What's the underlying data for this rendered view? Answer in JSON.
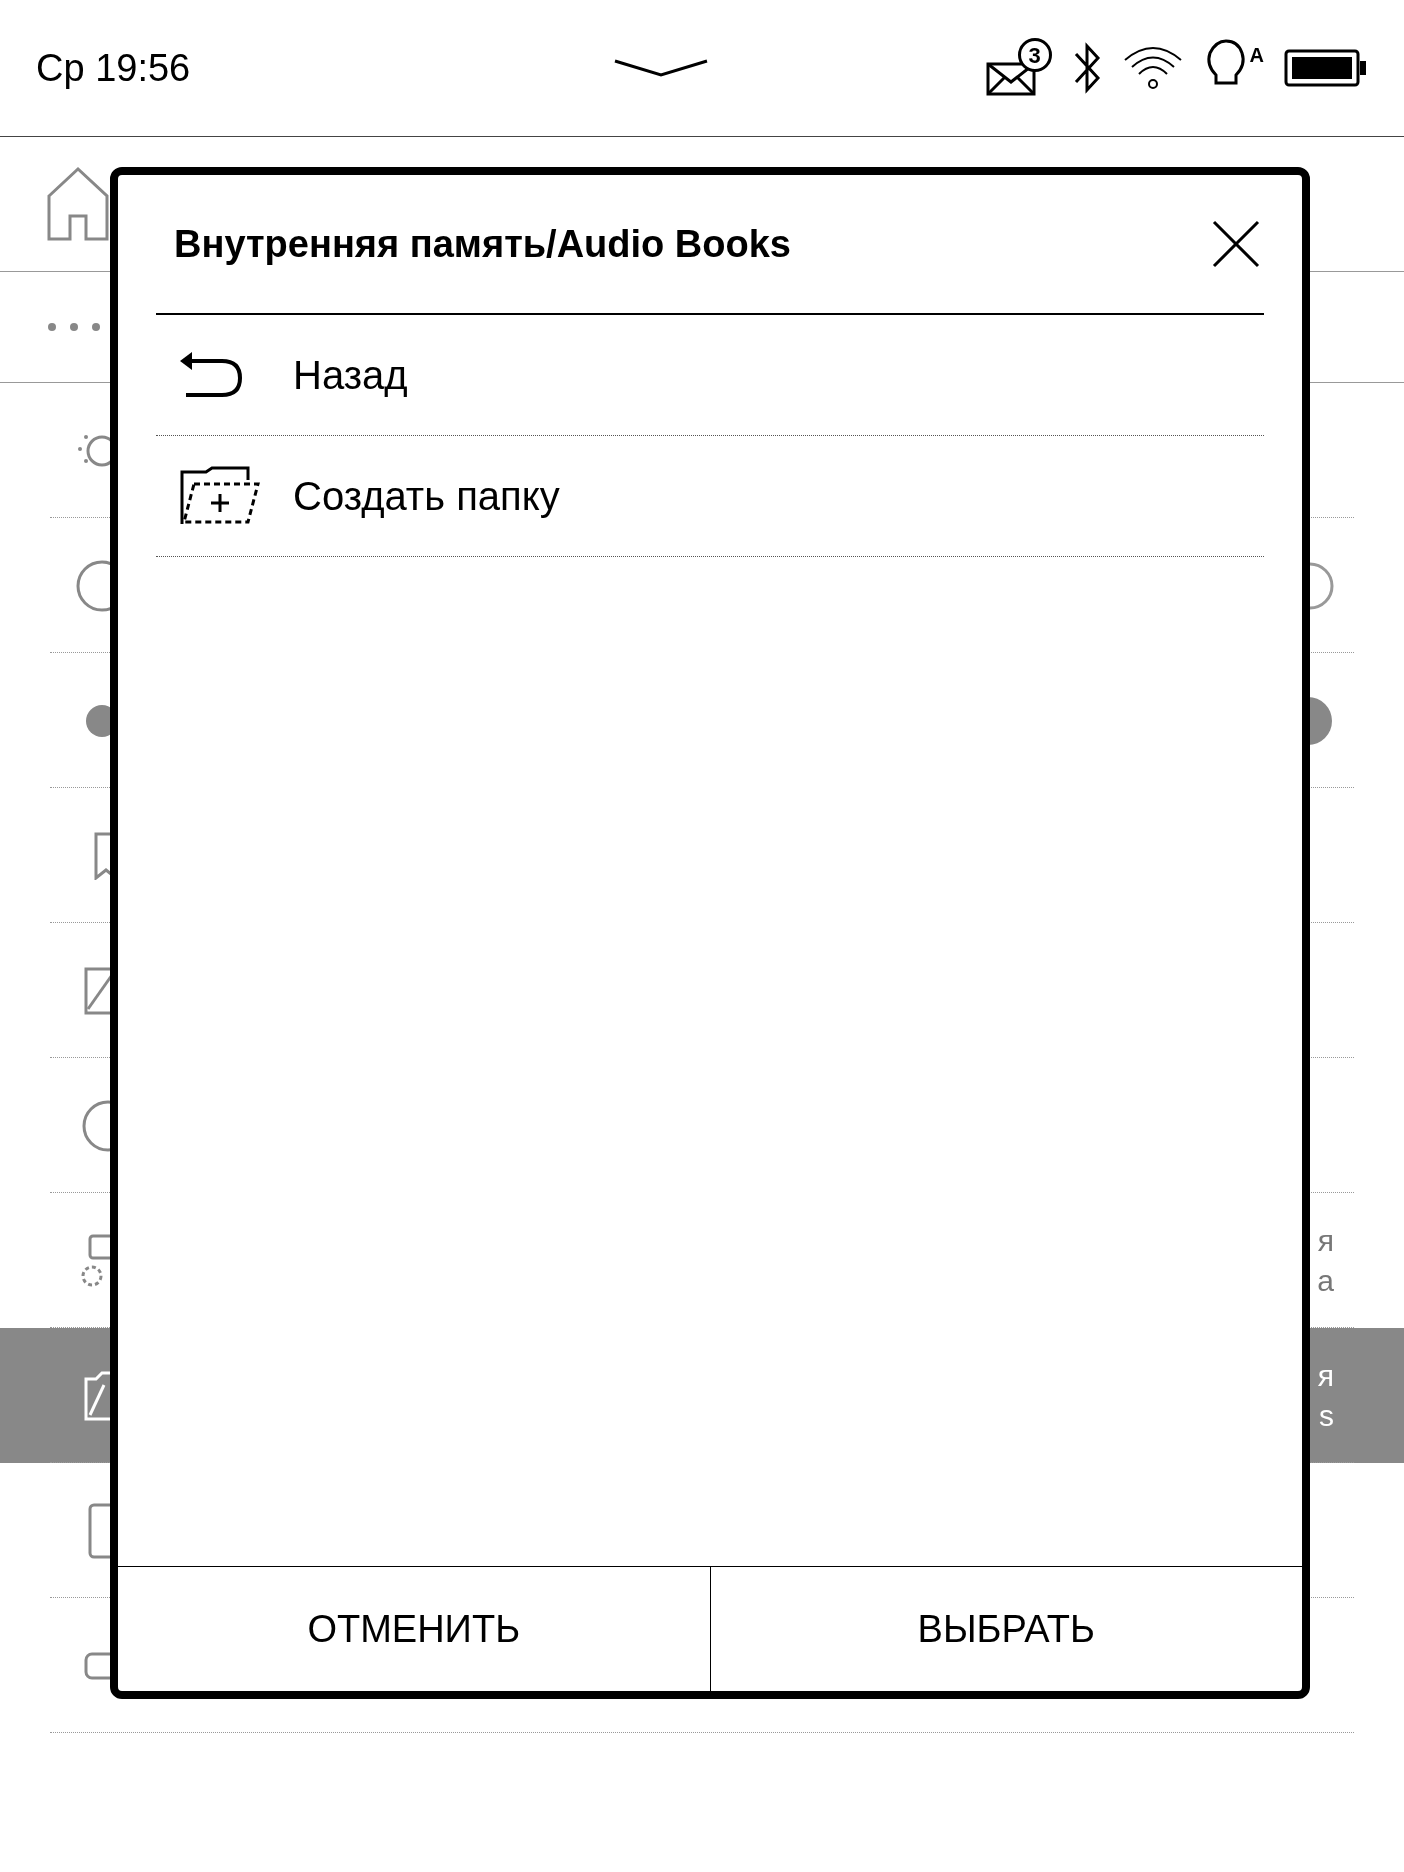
{
  "status_bar": {
    "clock": "Ср 19:56",
    "mail_badge": "3",
    "light_mode": "A"
  },
  "background_rows": [
    {
      "selected": false
    },
    {
      "selected": false
    },
    {
      "selected": false
    },
    {
      "selected": false
    },
    {
      "selected": false
    },
    {
      "selected": false
    },
    {
      "selected": false,
      "text_fragment": [
        "я",
        "а"
      ]
    },
    {
      "selected": true,
      "text_fragment": [
        "я",
        "s"
      ]
    },
    {
      "selected": false
    },
    {
      "selected": false
    }
  ],
  "dialog": {
    "title": "Внутренняя память/Audio Books",
    "items": [
      {
        "kind": "back",
        "label": "Назад"
      },
      {
        "kind": "new-folder",
        "label": "Создать папку"
      }
    ],
    "buttons": [
      "ОТМЕНИТЬ",
      "ВЫБРАТЬ"
    ]
  }
}
